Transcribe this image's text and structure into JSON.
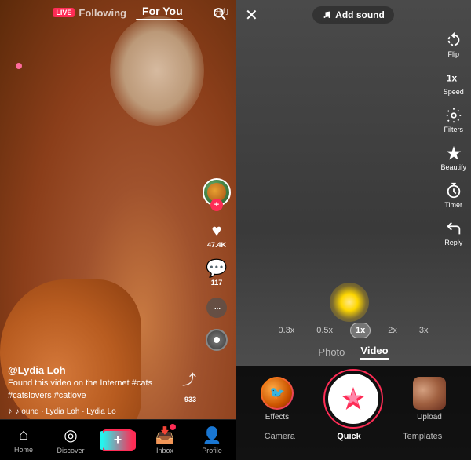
{
  "left": {
    "nav": {
      "live_badge": "LIVE",
      "following_label": "Following",
      "foryou_label": "For You"
    },
    "video": {
      "count_label": "开灯",
      "username": "@Lydia Loh",
      "description": "Found this video on the Internet #cats #catslovers #catlove",
      "music": "♪ ound · Lydia Loh · Lydia Lo",
      "likes": "47.4K",
      "comments": "117",
      "share_count": "933"
    },
    "bottom_nav": {
      "home": "Home",
      "discover": "Discover",
      "create": "+",
      "inbox": "Inbox",
      "profile": "Profile"
    }
  },
  "right": {
    "top": {
      "close": "✕",
      "add_sound": "Add sound"
    },
    "tools": [
      {
        "label": "Flip",
        "icon": "🔄"
      },
      {
        "label": "Speed",
        "icon": "1x"
      },
      {
        "label": "Filters",
        "icon": "⚙"
      },
      {
        "label": "Beautify",
        "icon": "✦"
      },
      {
        "label": "Timer",
        "icon": "⏱"
      },
      {
        "label": "Reply",
        "icon": "↩"
      }
    ],
    "speed_options": [
      "0.3x",
      "0.5x",
      "1x",
      "2x",
      "3x"
    ],
    "speed_active": "1x",
    "mode_tabs": [
      "Photo",
      "Video"
    ],
    "mode_active": "Video",
    "bottom_nav": [
      "Camera",
      "Quick",
      "Templates"
    ],
    "bottom_nav_active": "Quick",
    "effects_label": "Effects",
    "upload_label": "Upload"
  }
}
